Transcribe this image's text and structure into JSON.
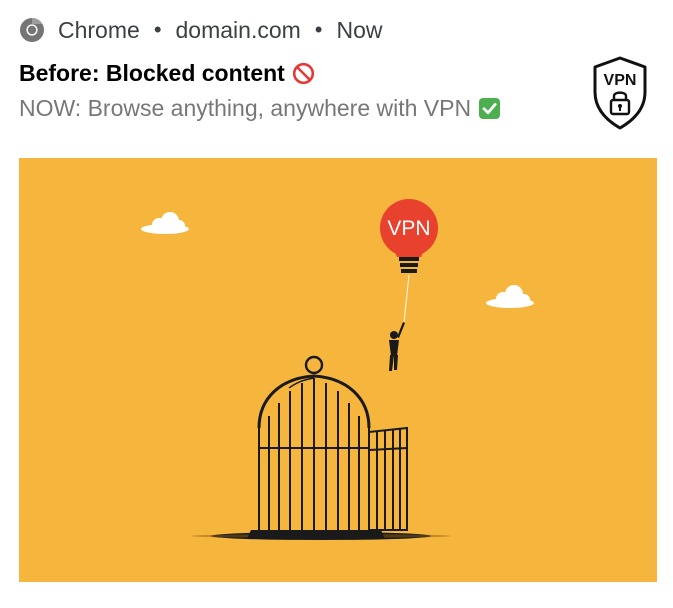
{
  "notification": {
    "app_name": "Chrome",
    "separator": "•",
    "source": "domain.com",
    "time": "Now",
    "title": "Before: Blocked content",
    "body": "NOW: Browse anything, anywhere with VPN",
    "title_emoji": "no-entry-sign-icon",
    "body_emoji": "check-mark-button-icon"
  },
  "icon": {
    "label": "VPN",
    "name": "vpn-shield-lock-icon"
  },
  "hero_image": {
    "balloon_label": "VPN",
    "background_color": "#f6b53d",
    "balloon_color": "#e8412d"
  }
}
